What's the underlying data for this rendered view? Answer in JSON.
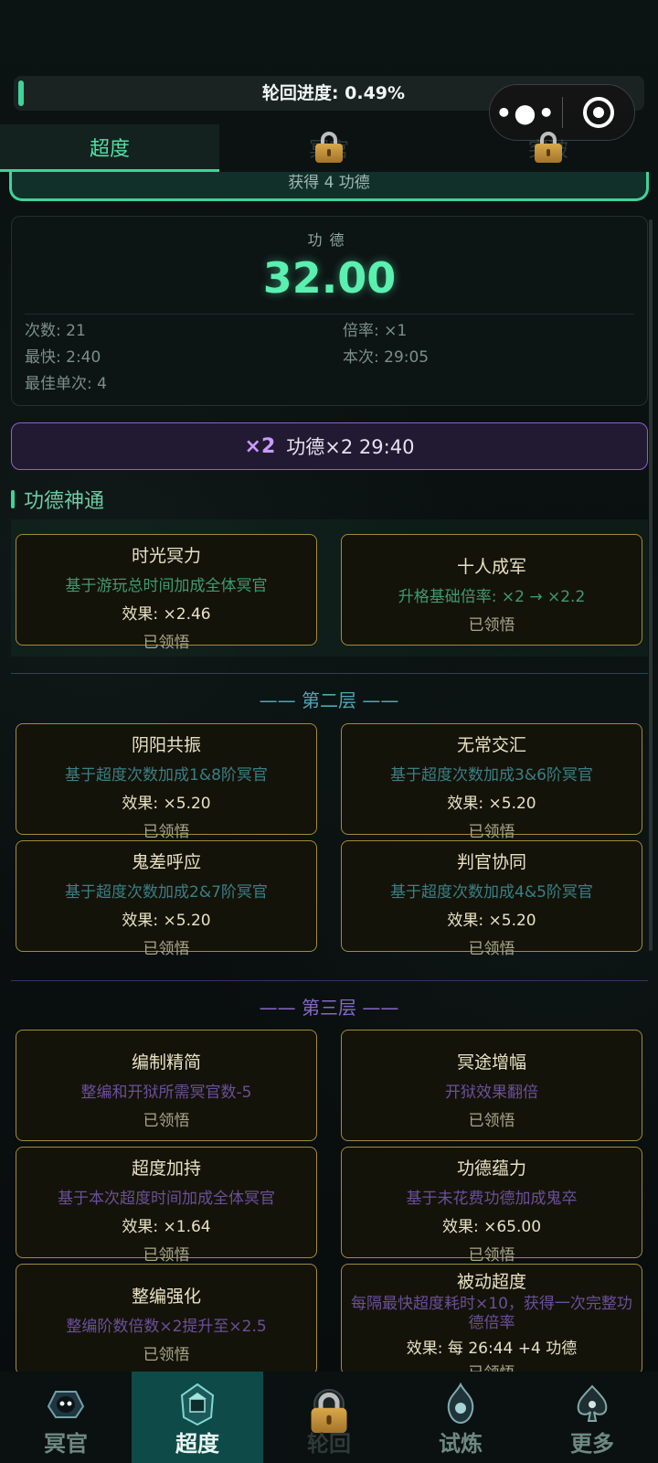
{
  "progress": {
    "label": "轮回进度: 0.49%",
    "fraction": 0.0049
  },
  "top_tabs": [
    {
      "label": "超度",
      "locked": false
    },
    {
      "label": "冥官",
      "locked": true
    },
    {
      "label": "突破",
      "locked": true
    }
  ],
  "reward_strip": "获得 4 功德",
  "merit": {
    "label": "功德",
    "value": "32.00",
    "count": "次数: 21",
    "fastest": "最快: 2:40",
    "best_single": "最佳单次: 4",
    "multiplier": "倍率: ×1",
    "current": "本次: 29:05"
  },
  "boost": {
    "badge": "×2",
    "text": "功德×2 29:40"
  },
  "section_title": "功德神通",
  "tier1": [
    {
      "title": "时光冥力",
      "desc": "基于游玩总时间加成全体冥官",
      "effect": "效果: ×2.46",
      "status": "已领悟"
    },
    {
      "title": "十人成军",
      "desc": "升格基础倍率: ×2 → ×2.2",
      "status": "已领悟"
    }
  ],
  "tier2": {
    "title": "—— 第二层 ——",
    "cards": [
      {
        "title": "阴阳共振",
        "desc": "基于超度次数加成1&8阶冥官",
        "effect": "效果: ×5.20",
        "status": "已领悟"
      },
      {
        "title": "无常交汇",
        "desc": "基于超度次数加成3&6阶冥官",
        "effect": "效果: ×5.20",
        "status": "已领悟"
      },
      {
        "title": "鬼差呼应",
        "desc": "基于超度次数加成2&7阶冥官",
        "effect": "效果: ×5.20",
        "status": "已领悟"
      },
      {
        "title": "判官协同",
        "desc": "基于超度次数加成4&5阶冥官",
        "effect": "效果: ×5.20",
        "status": "已领悟"
      }
    ]
  },
  "tier3": {
    "title": "—— 第三层 ——",
    "cards": [
      {
        "title": "编制精简",
        "desc": "整编和开狱所需冥官数-5",
        "status": "已领悟"
      },
      {
        "title": "冥途增幅",
        "desc": "开狱效果翻倍",
        "status": "已领悟"
      },
      {
        "title": "超度加持",
        "desc": "基于本次超度时间加成全体冥官",
        "effect": "效果: ×1.64",
        "status": "已领悟"
      },
      {
        "title": "功德蕴力",
        "desc": "基于未花费功德加成鬼卒",
        "effect": "效果: ×65.00",
        "status": "已领悟"
      },
      {
        "title": "整编强化",
        "desc": "整编阶数倍数×2提升至×2.5",
        "status": "已领悟"
      },
      {
        "title": "被动超度",
        "desc": "每隔最快超度耗时×10，获得一次完整功德倍率",
        "effect": "效果: 每 26:44 +4 功德",
        "status": "已领悟"
      }
    ]
  },
  "bottom_nav": [
    {
      "label": "冥官",
      "icon": "ghost-emblem-icon",
      "locked": false,
      "active": false
    },
    {
      "label": "超度",
      "icon": "shrine-emblem-icon",
      "locked": false,
      "active": true
    },
    {
      "label": "轮回",
      "icon": "cycle-emblem-icon",
      "locked": true,
      "active": false
    },
    {
      "label": "试炼",
      "icon": "flame-emblem-icon",
      "locked": false,
      "active": false
    },
    {
      "label": "更多",
      "icon": "spade-emblem-icon",
      "locked": false,
      "active": false
    }
  ],
  "colors": {
    "accent": "#3fd39a",
    "merit_value": "#5af0b0",
    "boost_border": "#8a63c9",
    "card_border": "#a38a3a"
  }
}
